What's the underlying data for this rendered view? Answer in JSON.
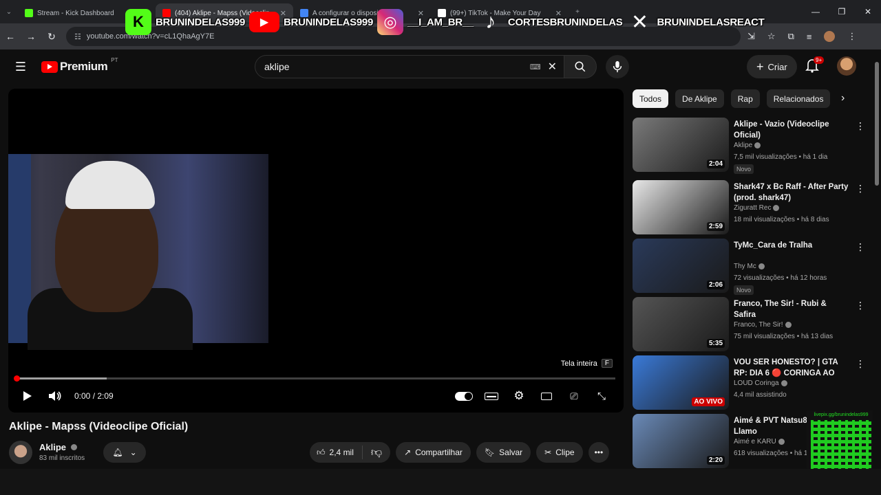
{
  "browser": {
    "tabs": [
      {
        "label": "Stream - Kick Dashboard",
        "color": "#53fc18"
      },
      {
        "label": "(404) Aklipe - Mapss (Videoclip",
        "color": "#ff0000"
      },
      {
        "label": "A configurar o disposi",
        "color": "#4285f4"
      },
      {
        "label": "(99+) TikTok - Make Your Day",
        "color": "#ffffff"
      }
    ],
    "new_tab": "+",
    "url": "youtube.com/watch?v=cL1QhaAgY7E"
  },
  "overlay": [
    {
      "name": "BRUNINDELAS999",
      "icon": "kick-logo",
      "color": "#53fc18",
      "glyph": "K"
    },
    {
      "name": "BRUNINDELAS999",
      "icon": "youtube-logo",
      "color": "#ff0000",
      "glyph": "▶"
    },
    {
      "name": "__I_AM_BR__",
      "icon": "instagram-logo",
      "color": "#d62976",
      "glyph": "◎"
    },
    {
      "name": "CORTESBRUNINDELAS",
      "icon": "tiktok-logo",
      "color": "#000000",
      "glyph": "♪"
    },
    {
      "name": "BRUNINDELASREACT",
      "icon": "x-logo",
      "color": "#000000",
      "glyph": "𝕏"
    }
  ],
  "header": {
    "logo": "Premium",
    "logo_region": "PT",
    "search_value": "aklipe",
    "create_label": "Criar",
    "notif_count": "9+"
  },
  "player": {
    "fullscreen_label": "Tela inteira",
    "fullscreen_key": "F",
    "time": "0:00 / 2:09",
    "progress_buffered": 0.15
  },
  "video": {
    "title": "Aklipe - Mapss (Videoclipe Oficial)",
    "channel": "Aklipe",
    "subscribers": "83 mil inscritos",
    "likes": "2,4 mil",
    "share": "Compartilhar",
    "save": "Salvar",
    "clip": "Clipe"
  },
  "chips": [
    "Todos",
    "De Aklipe",
    "Rap",
    "Relacionados"
  ],
  "recommendations": [
    {
      "title": "Aklipe - Vazio (Videoclipe Oficial)",
      "channel": "Aklipe",
      "meta": "7,5 mil visualizações • há 1 dia",
      "badge": "Novo",
      "duration": "2:04",
      "thumb": "#7a7a7a"
    },
    {
      "title": "Shark47 x Bc Raff - After Party (prod. shark47)",
      "channel": "Ziguratt Rec",
      "meta": "18 mil visualizações • há 8 dias",
      "badge": "",
      "duration": "2:59",
      "thumb": "#e8e8e8"
    },
    {
      "title": "TyMc_Cara de Tralha",
      "channel": "Thy Mc",
      "meta": "72 visualizações • há 12 horas",
      "badge": "Novo",
      "duration": "2:06",
      "thumb": "#2a3a5a"
    },
    {
      "title": "Franco, The Sir! - Rubi & Safira",
      "channel": "Franco, The Sir!",
      "meta": "75 mil visualizações • há 13 dias",
      "badge": "",
      "duration": "5:35",
      "thumb": "#555555"
    },
    {
      "title": "VOU SER HONESTO? | GTA RP: DIA 6 🔴 CORINGA AO VIVO",
      "channel": "LOUD Coringa",
      "meta": "4,4 mil assistindo",
      "badge": "",
      "duration": "AO VIVO",
      "thumb": "#3a7ad8"
    },
    {
      "title": "Aimé & PVT Natsu8 - me Llamo",
      "channel": "Aimé e KARU",
      "meta": "618 visualizações • há 1",
      "badge": "",
      "duration": "2:20",
      "thumb": "#6a8ab8"
    }
  ],
  "qr": {
    "label": "livepix.gg/brunindelas999"
  }
}
